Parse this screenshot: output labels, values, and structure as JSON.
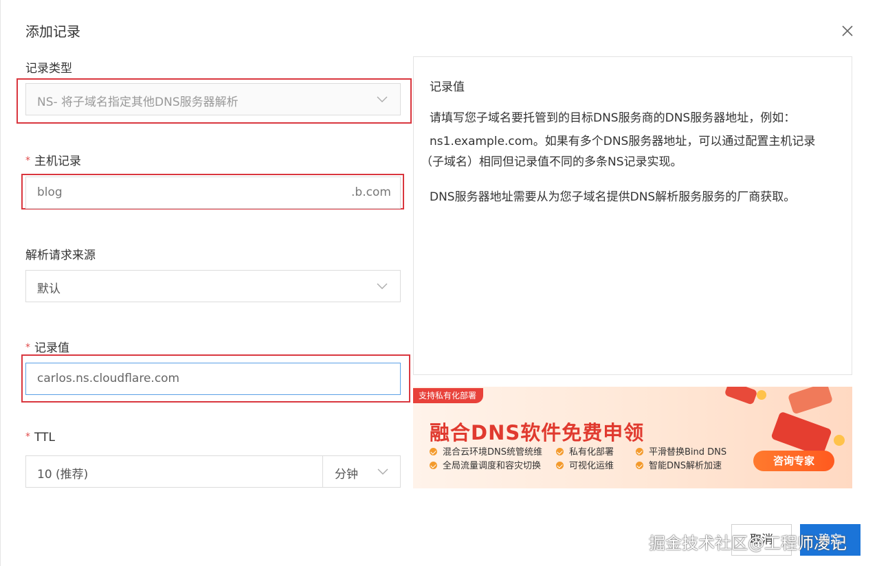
{
  "dialog": {
    "title": "添加记录",
    "close_icon": "close-icon"
  },
  "form": {
    "record_type": {
      "label": "记录类型",
      "value": "NS- 将子域名指定其他DNS服务器解析"
    },
    "host": {
      "required_mark": "*",
      "label": "主机记录",
      "value": "blog",
      "suffix": ".b.com"
    },
    "source": {
      "label": "解析请求来源",
      "value": "默认"
    },
    "record_value": {
      "required_mark": "*",
      "label": "记录值",
      "value": "carlos.ns.cloudflare.com"
    },
    "ttl": {
      "required_mark": "*",
      "label": "TTL",
      "value": "10 (推荐)",
      "unit": "分钟"
    }
  },
  "help": {
    "title": "记录值",
    "line1": "请填写您子域名要托管到的目标DNS服务商的DNS服务器地址，例如：",
    "line2": "ns1.example.com。如果有多个DNS服务器地址，可以通过配置主机记录",
    "line3": "（子域名）相同但记录值不同的多条NS记录实现。",
    "line4": "DNS服务器地址需要从为您子域名提供DNS解析服务服务的厂商获取。"
  },
  "banner": {
    "badge": "支持私有化部署",
    "title": "融合DNS软件免费申领",
    "features": [
      "混合云环境DNS统管统维",
      "私有化部署",
      "平滑替换Bind DNS",
      "全局流量调度和容灾切换",
      "可视化运维",
      "智能DNS解析加速"
    ],
    "cta": "咨询专家",
    "accent_color": "#e03a2f"
  },
  "footer": {
    "cancel_label": "取消",
    "ok_label": "确定"
  },
  "watermark": "掘金技术社区@工程师凌记",
  "colors": {
    "highlight_border": "#d9363e",
    "primary": "#1b74d8",
    "focus_border": "#5aa0e6"
  }
}
